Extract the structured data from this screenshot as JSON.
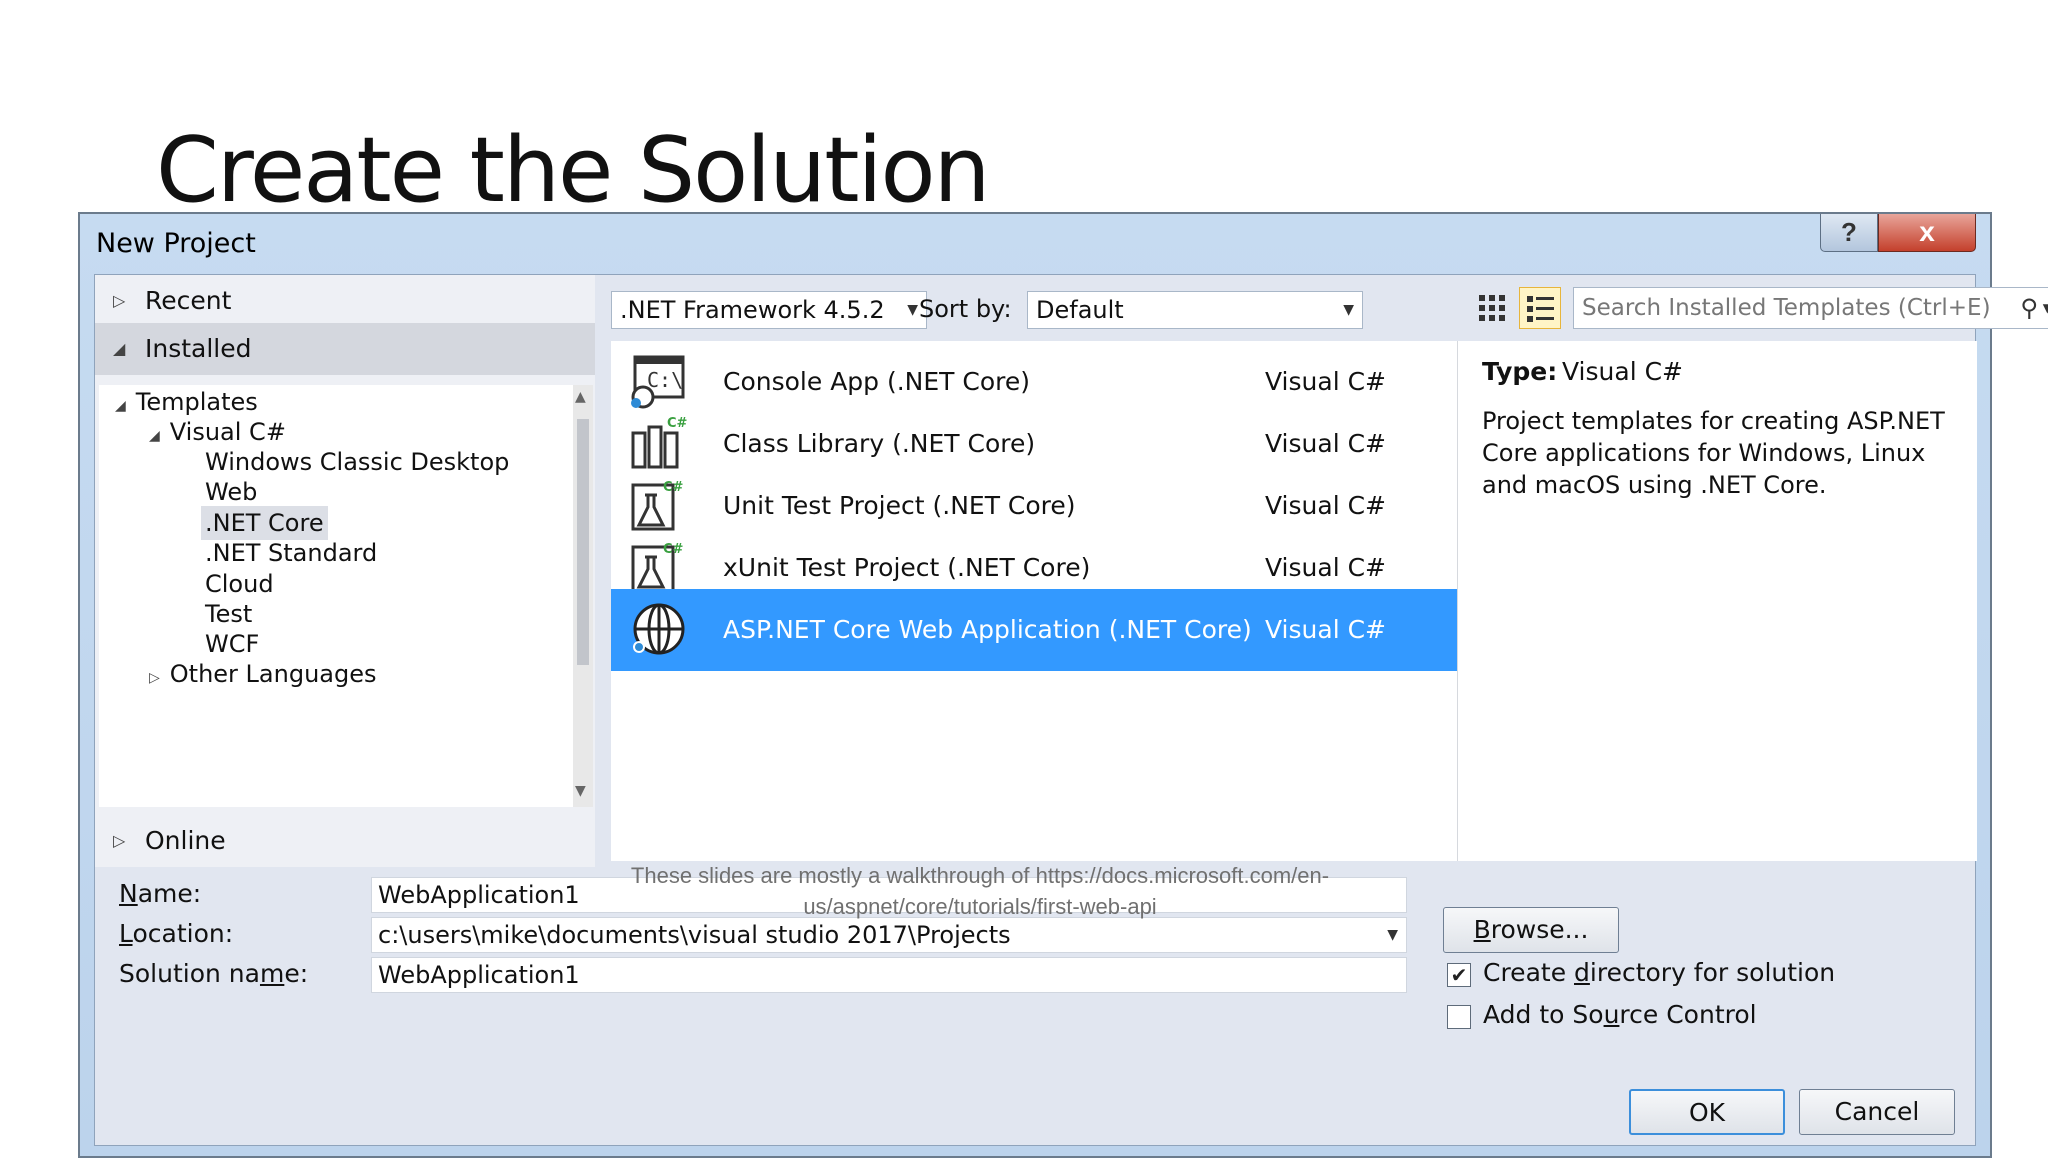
{
  "slide": {
    "title": "Create the Solution"
  },
  "window": {
    "title": "New Project",
    "help_label": "?",
    "close_label": "x"
  },
  "nav": {
    "recent": "Recent",
    "installed": "Installed",
    "online": "Online",
    "tree": {
      "templates": "Templates",
      "visual_cs": "Visual C#",
      "children": [
        "Windows Classic Desktop",
        "Web",
        ".NET Core",
        ".NET Standard",
        "Cloud",
        "Test",
        "WCF"
      ],
      "selected": ".NET Core",
      "other_languages": "Other Languages"
    }
  },
  "toolbar": {
    "framework": ".NET Framework 4.5.2",
    "sort_label": "Sort by:",
    "sort_value": "Default",
    "search_placeholder": "Search Installed Templates (Ctrl+E)",
    "view_grid_icon": "grid-view-icon",
    "view_list_icon": "list-view-icon"
  },
  "templates": [
    {
      "name": "Console App (.NET Core)",
      "lang": "Visual C#",
      "icon": "console-app-icon",
      "selected": false
    },
    {
      "name": "Class Library (.NET Core)",
      "lang": "Visual C#",
      "icon": "class-library-icon",
      "selected": false
    },
    {
      "name": "Unit Test Project (.NET Core)",
      "lang": "Visual C#",
      "icon": "unit-test-icon",
      "selected": false
    },
    {
      "name": "xUnit Test Project (.NET Core)",
      "lang": "Visual C#",
      "icon": "xunit-test-icon",
      "selected": false
    },
    {
      "name": "ASP.NET Core Web Application (.NET Core)",
      "lang": "Visual C#",
      "icon": "web-app-globe-icon",
      "selected": true
    }
  ],
  "details": {
    "type_label": "Type:",
    "type_value": "Visual C#",
    "description": "Project templates for creating ASP.NET Core applications for Windows, Linux and macOS using .NET Core."
  },
  "form": {
    "name_label": "Name:",
    "name_value": "WebApplication1",
    "location_label": "Location:",
    "location_value": "c:\\users\\mike\\documents\\visual studio 2017\\Projects",
    "solution_label": "Solution name:",
    "solution_value": "WebApplication1",
    "browse_label": "Browse...",
    "create_dir_label": "Create directory for solution",
    "create_dir_checked": true,
    "source_control_label": "Add to Source Control",
    "source_control_checked": false,
    "ok_label": "OK",
    "cancel_label": "Cancel"
  },
  "footnote": "These slides are mostly a walkthrough of https://docs.microsoft.com/en-us/aspnet/core/tutorials/first-web-api",
  "colors": {
    "selection": "#3399ff",
    "window_chrome": "#c6dbf1",
    "close_button": "#c4402c"
  }
}
